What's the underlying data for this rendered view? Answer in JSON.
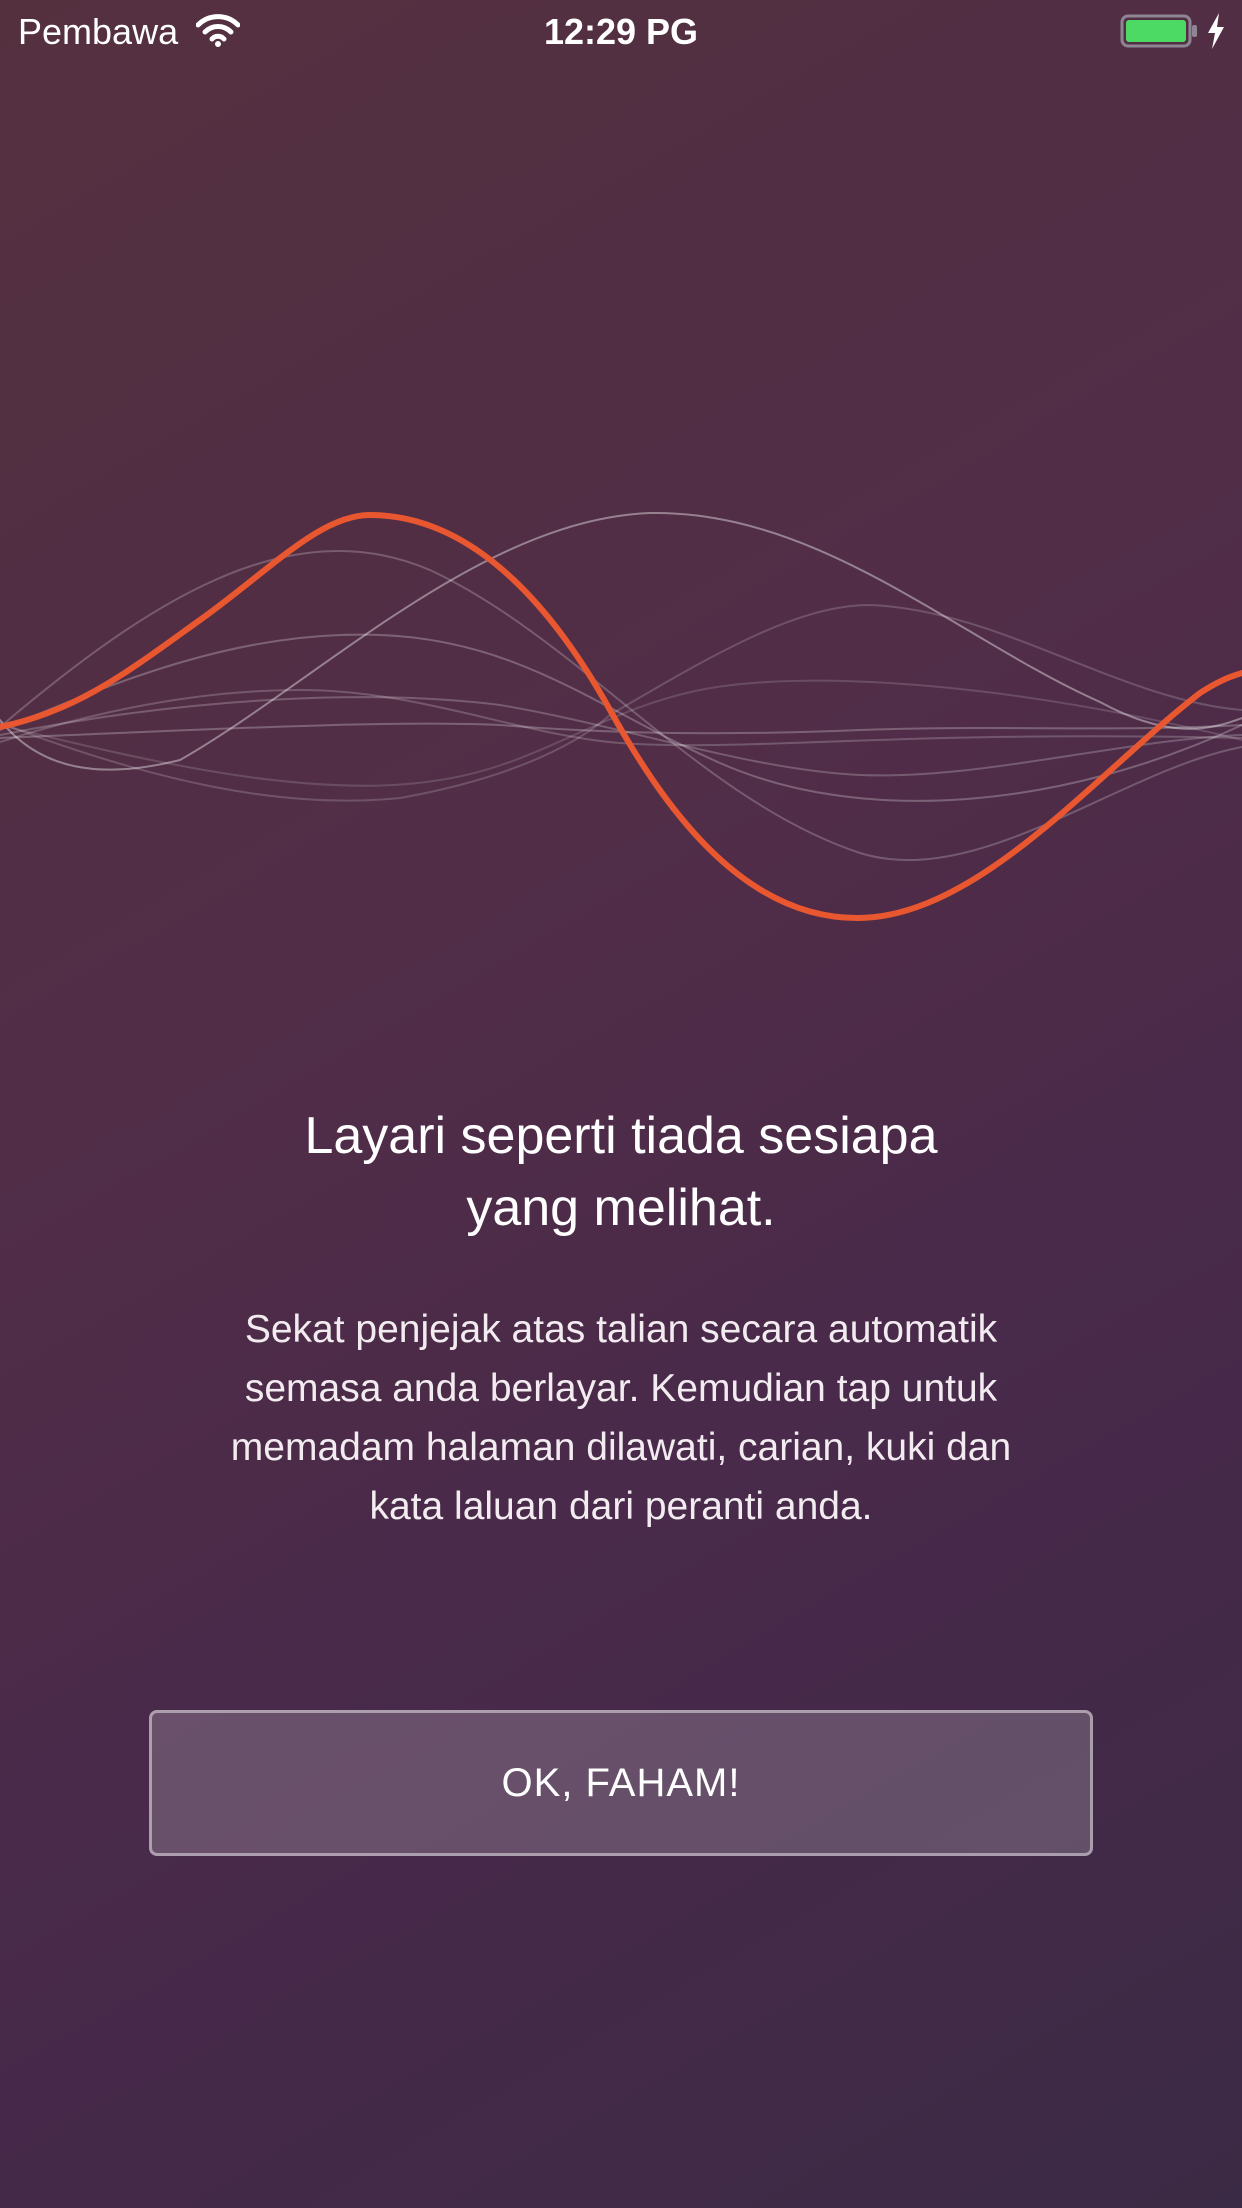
{
  "status_bar": {
    "carrier": "Pembawa",
    "time": "12:29 PG",
    "icons": [
      "wifi-icon",
      "battery-icon",
      "charging-icon"
    ],
    "battery_color": "#4cd964",
    "battery_level": 1.0
  },
  "onboarding": {
    "headline_line1": "Layari seperti tiada sesiapa",
    "headline_line2": "yang melihat.",
    "body_line1": "Sekat penjejak atas talian secara automatik",
    "body_line2": "semasa anda berlayar. Kemudian tap untuk",
    "body_line3": "memadam halaman dilawati, carian, kuki dan",
    "body_line4": "kata laluan dari peranti anda.",
    "button_label": "OK, FAHAM!"
  },
  "colors": {
    "accent_wave": "#e8572f",
    "background_top": "#54303f",
    "background_bottom": "#3b2a45"
  }
}
